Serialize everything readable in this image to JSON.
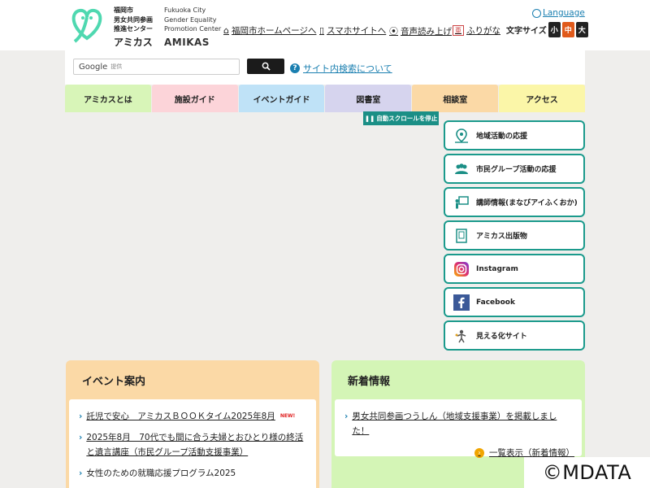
{
  "header": {
    "logo_jp_lines": [
      "福岡市",
      "男女共同参画",
      "推進センター"
    ],
    "logo_jp_name": "アミカス",
    "logo_en_lines": [
      "Fukuoka City",
      "Gender Equality",
      "Promotion Center"
    ],
    "logo_en_name": "AMIKAS",
    "links": [
      {
        "label": "福岡市ホームページへ",
        "icon": "house-icon"
      },
      {
        "label": "スマホサイトへ",
        "icon": "smartphone-icon"
      },
      {
        "label": "音声読み上げ",
        "icon": "speaker-icon"
      },
      {
        "label": "ふりがな",
        "icon": "furigana-icon"
      }
    ],
    "language_label": "Language",
    "fontsize_label": "文字サイズ",
    "fontsize_buttons": [
      {
        "label": "小",
        "color": "#222222"
      },
      {
        "label": "中",
        "color": "#e05a1b"
      },
      {
        "label": "大",
        "color": "#222222"
      }
    ]
  },
  "search": {
    "brand": "Google",
    "brand_sub": "提供",
    "help_label": "サイト内検索について"
  },
  "nav": [
    {
      "label": "アミカスとは",
      "color": "#d8f5b8"
    },
    {
      "label": "施設ガイド",
      "color": "#fcd4d9"
    },
    {
      "label": "イベントガイド",
      "color": "#bfe2f7"
    },
    {
      "label": "図書室",
      "color": "#d6d4ee"
    },
    {
      "label": "相談室",
      "color": "#fbd9a6"
    },
    {
      "label": "アクセス",
      "color": "#fbf6a8"
    }
  ],
  "scroll_stop_label": "自動スクロールを停止",
  "side_links": [
    {
      "label": "地域活動の応援",
      "icon": "map-pin-icon"
    },
    {
      "label": "市民グループ活動の応援",
      "icon": "group-icon"
    },
    {
      "label": "講師情報(まなびアイふくおか)",
      "icon": "lecturer-icon"
    },
    {
      "label": "アミカス出版物",
      "icon": "book-icon"
    },
    {
      "label": "Instagram",
      "icon": "instagram-icon"
    },
    {
      "label": "Facebook",
      "icon": "facebook-icon"
    },
    {
      "label": "見える化サイト",
      "icon": "visualization-icon"
    }
  ],
  "events": {
    "title": "イベント案内",
    "items": [
      {
        "text": "託児で安心　アミカスＢＯＯＫタイム2025年8月",
        "badge": "NEW!"
      },
      {
        "text": "2025年8月　70代でも間に合う夫婦とおひとり様の終活と遺言講座（市民グループ活動支援事業）",
        "badge": ""
      },
      {
        "text": "女性のための就職応援プログラム2025",
        "badge": ""
      }
    ]
  },
  "news": {
    "title": "新着情報",
    "items": [
      {
        "text": "男女共同参画つうしん（地域支援事業）を掲載しました！"
      }
    ],
    "more_label": "一覧表示（新着情報）"
  },
  "watermark": "©MDATA"
}
